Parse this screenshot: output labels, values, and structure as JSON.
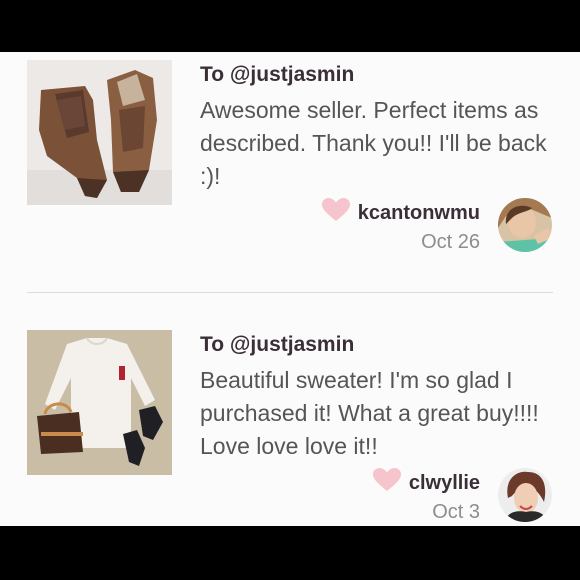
{
  "reviews": [
    {
      "to": "To @justjasmin",
      "message": "Awesome seller. Perfect items as described. Thank you!! I'll be back :)!",
      "username": "kcantonwmu",
      "date": "Oct 26",
      "thumbnail_icon": "boots-photo",
      "heart_color": "#f6c4cc"
    },
    {
      "to": "To @justjasmin",
      "message": "Beautiful sweater! I'm so glad I purchased it! What a great buy!!!! Love love love it!!",
      "username": "clwyllie",
      "date": "Oct 3",
      "thumbnail_icon": "sweater-outfit-photo",
      "heart_color": "#f6c4cc"
    }
  ]
}
